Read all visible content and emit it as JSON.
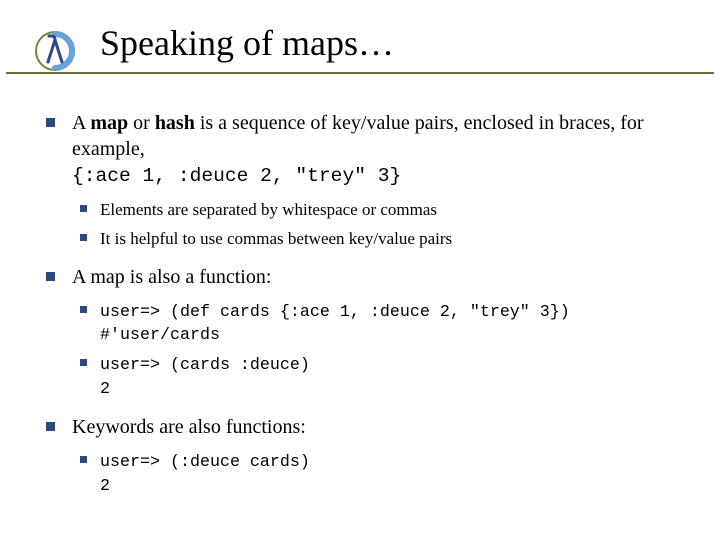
{
  "title": "Speaking of maps…",
  "bullets": [
    {
      "kind": "mixed",
      "runs": [
        {
          "t": "A ",
          "b": false,
          "m": false
        },
        {
          "t": "map",
          "b": true,
          "m": false
        },
        {
          "t": " or ",
          "b": false,
          "m": false
        },
        {
          "t": "hash",
          "b": true,
          "m": false
        },
        {
          "t": " is a sequence of key/value pairs, enclosed in braces, for example,",
          "b": false,
          "m": false
        },
        {
          "br": true
        },
        {
          "t": "{:ace 1, :deuce 2, \"trey\" 3}",
          "b": false,
          "m": true
        }
      ],
      "subs": [
        {
          "kind": "plain",
          "text": "Elements are separated by whitespace or commas"
        },
        {
          "kind": "plain",
          "text": "It is helpful to use commas between key/value pairs"
        }
      ]
    },
    {
      "kind": "plain",
      "text": "A map is also a function:",
      "subs": [
        {
          "kind": "mixed",
          "runs": [
            {
              "t": "user=> (def cards {:ace 1, :deuce 2, \"trey\" 3})",
              "b": false,
              "m": true
            },
            {
              "br": true
            },
            {
              "t": "#'user/cards",
              "b": false,
              "m": true
            }
          ]
        },
        {
          "kind": "mixed",
          "runs": [
            {
              "t": "user=> (cards  :deuce)",
              "b": false,
              "m": true
            },
            {
              "br": true
            },
            {
              "t": "2",
              "b": false,
              "m": true
            }
          ]
        }
      ]
    },
    {
      "kind": "plain",
      "text": "Keywords are also functions:",
      "subs": [
        {
          "kind": "mixed",
          "runs": [
            {
              "t": "user=> (:deuce  cards)",
              "b": false,
              "m": true
            },
            {
              "br": true
            },
            {
              "t": "2",
              "b": false,
              "m": true
            }
          ]
        }
      ]
    }
  ],
  "logo": {
    "outer_ring": "#6a8a3a",
    "lambda": "#2a4a8a",
    "swirl": "#6aa0d8"
  }
}
